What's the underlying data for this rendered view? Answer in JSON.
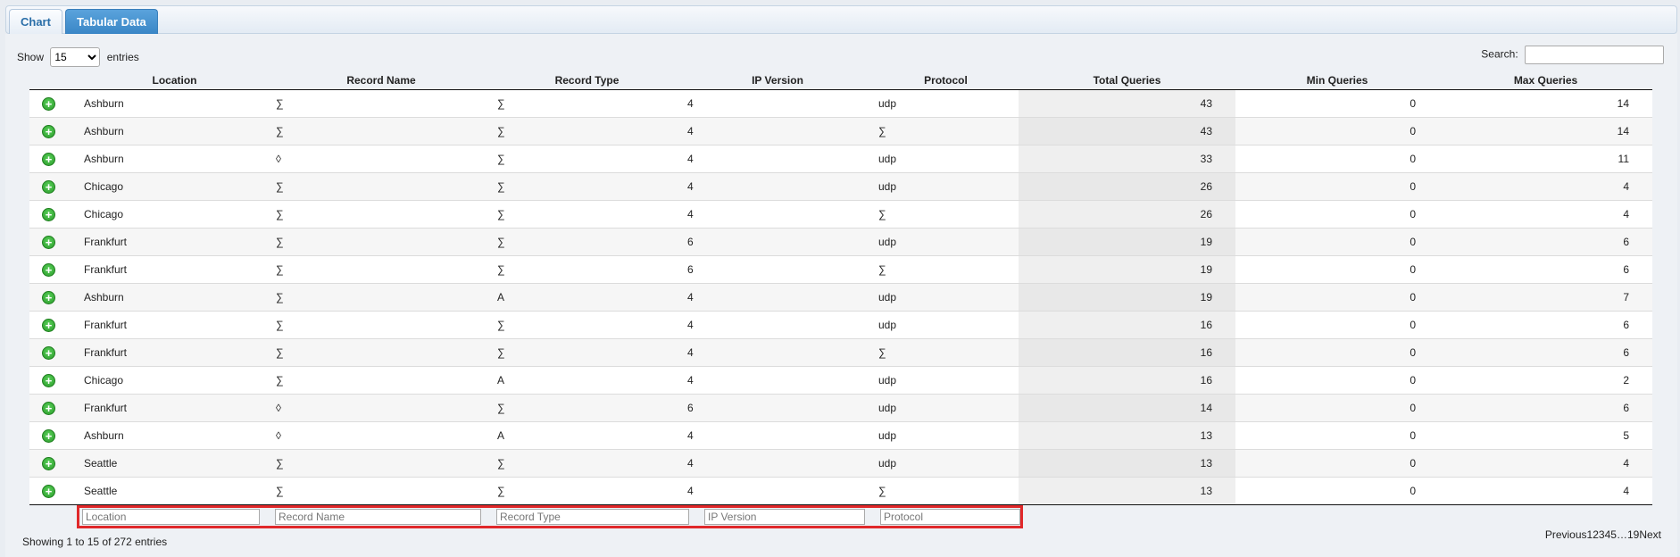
{
  "tabs": [
    {
      "label": "Chart"
    },
    {
      "label": "Tabular Data"
    }
  ],
  "length": {
    "show_label": "Show",
    "value": "15",
    "entries_label": "entries"
  },
  "search": {
    "label": "Search:",
    "value": ""
  },
  "columns": [
    "Location",
    "Record Name",
    "Record Type",
    "IP Version",
    "Protocol",
    "Total Queries",
    "Min Queries",
    "Max Queries"
  ],
  "rows": [
    [
      "Ashburn",
      "∑",
      "∑",
      "4",
      "udp",
      "43",
      "0",
      "14"
    ],
    [
      "Ashburn",
      "∑",
      "∑",
      "4",
      "∑",
      "43",
      "0",
      "14"
    ],
    [
      "Ashburn",
      "◊",
      "∑",
      "4",
      "udp",
      "33",
      "0",
      "11"
    ],
    [
      "Chicago",
      "∑",
      "∑",
      "4",
      "udp",
      "26",
      "0",
      "4"
    ],
    [
      "Chicago",
      "∑",
      "∑",
      "4",
      "∑",
      "26",
      "0",
      "4"
    ],
    [
      "Frankfurt",
      "∑",
      "∑",
      "6",
      "udp",
      "19",
      "0",
      "6"
    ],
    [
      "Frankfurt",
      "∑",
      "∑",
      "6",
      "∑",
      "19",
      "0",
      "6"
    ],
    [
      "Ashburn",
      "∑",
      "A",
      "4",
      "udp",
      "19",
      "0",
      "7"
    ],
    [
      "Frankfurt",
      "∑",
      "∑",
      "4",
      "udp",
      "16",
      "0",
      "6"
    ],
    [
      "Frankfurt",
      "∑",
      "∑",
      "4",
      "∑",
      "16",
      "0",
      "6"
    ],
    [
      "Chicago",
      "∑",
      "A",
      "4",
      "udp",
      "16",
      "0",
      "2"
    ],
    [
      "Frankfurt",
      "◊",
      "∑",
      "6",
      "udp",
      "14",
      "0",
      "6"
    ],
    [
      "Ashburn",
      "◊",
      "A",
      "4",
      "udp",
      "13",
      "0",
      "5"
    ],
    [
      "Seattle",
      "∑",
      "∑",
      "4",
      "udp",
      "13",
      "0",
      "4"
    ],
    [
      "Seattle",
      "∑",
      "∑",
      "4",
      "∑",
      "13",
      "0",
      "4"
    ]
  ],
  "filters": [
    {
      "placeholder": "Location"
    },
    {
      "placeholder": "Record Name"
    },
    {
      "placeholder": "Record Type"
    },
    {
      "placeholder": "IP Version"
    },
    {
      "placeholder": "Protocol"
    }
  ],
  "info": "Showing 1 to 15 of 272 entries",
  "paging": {
    "previous": "Previous",
    "pages": [
      "1",
      "2",
      "3",
      "4",
      "5"
    ],
    "ellipsis": "…",
    "last": "19",
    "next": "Next"
  },
  "colors": {
    "highlight": "#e0282a",
    "tab_active": "#3a86c6",
    "expand_icon": "#2a9a2a"
  }
}
